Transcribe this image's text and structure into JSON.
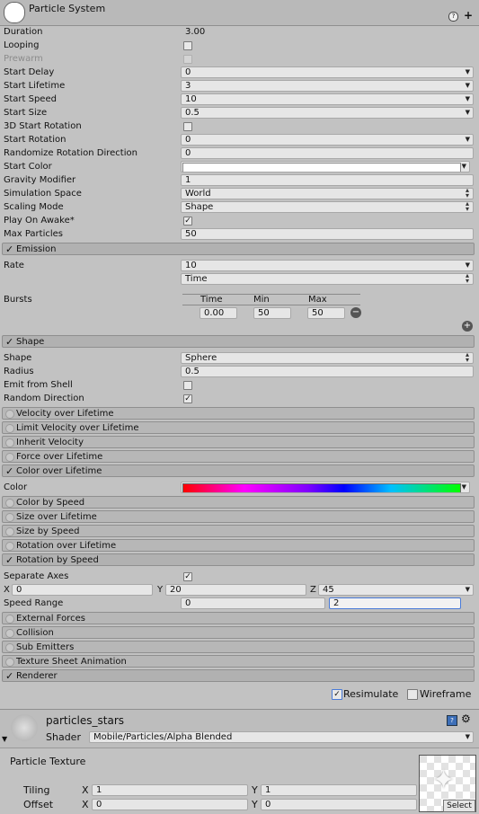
{
  "header": {
    "title": "Particle System",
    "help_icon": "help-icon",
    "add_icon": "plus-icon"
  },
  "main": {
    "duration": {
      "label": "Duration",
      "value": "3.00"
    },
    "looping": {
      "label": "Looping",
      "checked": false
    },
    "prewarm": {
      "label": "Prewarm",
      "checked": false
    },
    "start_delay": {
      "label": "Start Delay",
      "value": "0"
    },
    "start_lifetime": {
      "label": "Start Lifetime",
      "value": "3"
    },
    "start_speed": {
      "label": "Start Speed",
      "value": "10"
    },
    "start_size": {
      "label": "Start Size",
      "value": "0.5"
    },
    "start_3d_rotation": {
      "label": "3D Start Rotation",
      "checked": false
    },
    "start_rotation": {
      "label": "Start Rotation",
      "value": "0"
    },
    "randomize_rotation": {
      "label": "Randomize Rotation Direction",
      "value": "0"
    },
    "start_color": {
      "label": "Start Color",
      "color": "#ffffff"
    },
    "gravity": {
      "label": "Gravity Modifier",
      "value": "1"
    },
    "simulation_space": {
      "label": "Simulation Space",
      "value": "World"
    },
    "scaling_mode": {
      "label": "Scaling Mode",
      "value": "Shape"
    },
    "play_on_awake": {
      "label": "Play On Awake*",
      "checked": true
    },
    "max_particles": {
      "label": "Max Particles",
      "value": "50"
    }
  },
  "emission": {
    "title": "Emission",
    "rate": {
      "label": "Rate",
      "value": "10",
      "unit": "Time"
    },
    "bursts": {
      "label": "Bursts",
      "headers": [
        "Time",
        "Min",
        "Max"
      ],
      "row": [
        "0.00",
        "50",
        "50"
      ]
    }
  },
  "shape": {
    "title": "Shape",
    "shape": {
      "label": "Shape",
      "value": "Sphere"
    },
    "radius": {
      "label": "Radius",
      "value": "0.5"
    },
    "emit_from_shell": {
      "label": "Emit from Shell",
      "checked": false
    },
    "random_direction": {
      "label": "Random Direction",
      "checked": true
    }
  },
  "modules_a": [
    "Velocity over Lifetime",
    "Limit Velocity over Lifetime",
    "Inherit Velocity",
    "Force over Lifetime"
  ],
  "color_over_lifetime": {
    "title": "Color over Lifetime",
    "color_label": "Color"
  },
  "modules_b": [
    "Color by Speed",
    "Size over Lifetime",
    "Size by Speed",
    "Rotation over Lifetime"
  ],
  "rotation_by_speed": {
    "title": "Rotation by Speed",
    "separate_axes": {
      "label": "Separate Axes",
      "checked": true
    },
    "x": {
      "label": "X",
      "value": "0"
    },
    "y": {
      "label": "Y",
      "value": "20"
    },
    "z": {
      "label": "Z",
      "value": "45"
    },
    "speed_range": {
      "label": "Speed Range",
      "min": "0",
      "max": "2"
    }
  },
  "modules_c": [
    "External Forces",
    "Collision",
    "Sub Emitters",
    "Texture Sheet Animation"
  ],
  "renderer": {
    "title": "Renderer"
  },
  "footer": {
    "resimulate": "Resimulate",
    "resimulate_checked": true,
    "wireframe": "Wireframe",
    "wireframe_checked": false
  },
  "material": {
    "name": "particles_stars",
    "shader_label": "Shader",
    "shader_value": "Mobile/Particles/Alpha Blended",
    "texture_label": "Particle Texture",
    "tiling_label": "Tiling",
    "offset_label": "Offset",
    "tiling": {
      "x_label": "X",
      "x": "1",
      "y_label": "Y",
      "y": "1"
    },
    "offset": {
      "x_label": "X",
      "x": "0",
      "y_label": "Y",
      "y": "0"
    },
    "select_label": "Select"
  },
  "colors": {
    "gradient": [
      "#ff0000",
      "#ff00ff",
      "#0000ff",
      "#00ffff",
      "#00ff00"
    ],
    "accent": "#4a7bd8"
  }
}
